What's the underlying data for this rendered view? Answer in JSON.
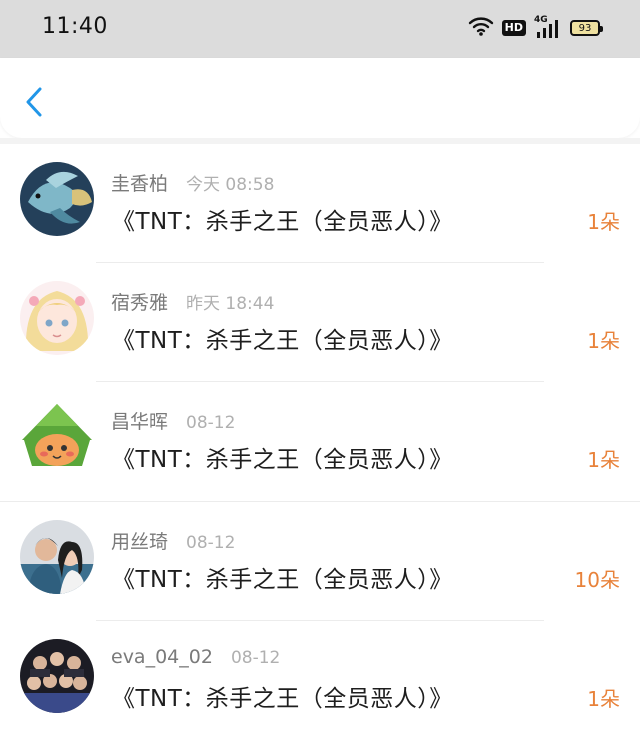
{
  "status_bar": {
    "time": "11:40",
    "hd_label": "HD",
    "network_label": "4G",
    "battery": "93"
  },
  "nav": {
    "back_icon": "chevron-left-icon",
    "accent": "#2196e8"
  },
  "items": [
    {
      "user": "圭香柏",
      "time": "今天 08:58",
      "title": "《TNT：杀手之王（全员恶人）》",
      "amount": "1朵",
      "avatar": "fish-avatar"
    },
    {
      "user": "宿秀雅",
      "time": "昨天 18:44",
      "title": "《TNT：杀手之王（全员恶人）》",
      "amount": "1朵",
      "avatar": "anime-girl-avatar"
    },
    {
      "user": "昌华晖",
      "time": "08-12",
      "title": "《TNT：杀手之王（全员恶人）》",
      "amount": "1朵",
      "avatar": "zongzi-avatar"
    },
    {
      "user": "用丝琦",
      "time": "08-12",
      "title": "《TNT：杀手之王（全员恶人）》",
      "amount": "10朵",
      "avatar": "couple-photo-avatar"
    },
    {
      "user": "eva_04_02",
      "time": "08-12",
      "title": "《TNT：杀手之王（全员恶人）》",
      "amount": "1朵",
      "avatar": "group-photo-avatar"
    }
  ],
  "colors": {
    "amount": "#e8823a",
    "name": "#7a7a7a",
    "time": "#b0b0b0"
  }
}
